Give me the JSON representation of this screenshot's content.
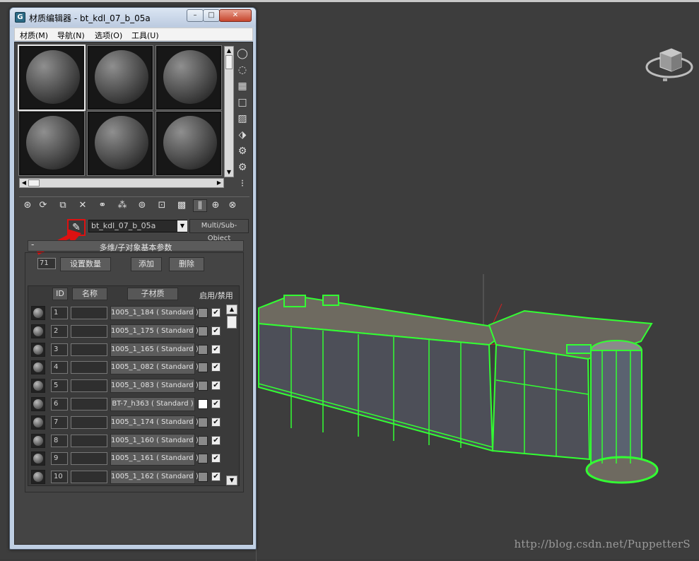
{
  "window": {
    "title": "材质编辑器 - bt_kdl_07_b_05a",
    "icon_glyph": "G"
  },
  "menu": [
    "材质(M)",
    "导航(N)",
    "选项(O)",
    "工具(U)"
  ],
  "material": {
    "name": "bt_kdl_07_b_05a",
    "type_button": "Multi/Sub-Object"
  },
  "rollout": {
    "title": "多维/子对象基本参数",
    "count": "71",
    "set_count_button": "设置数量",
    "add_button": "添加",
    "delete_button": "删除"
  },
  "columns": {
    "id": "ID",
    "name": "名称",
    "submaterial": "子材质",
    "enable": "启用/禁用"
  },
  "rows": [
    {
      "id": "1",
      "material": "1005_1_184 ( Standard )",
      "swatch": "#8a8a8a"
    },
    {
      "id": "2",
      "material": "1005_1_175 ( Standard )",
      "swatch": "#8a8a8a"
    },
    {
      "id": "3",
      "material": "1005_1_165 ( Standard )",
      "swatch": "#8a8a8a"
    },
    {
      "id": "4",
      "material": "1005_1_082 ( Standard )",
      "swatch": "#8a8a8a"
    },
    {
      "id": "5",
      "material": "1005_1_083 ( Standard )",
      "swatch": "#8a8a8a"
    },
    {
      "id": "6",
      "material": "BT-7_h363 ( Standard )",
      "swatch": "#ffffff"
    },
    {
      "id": "7",
      "material": "1005_1_174 ( Standard )",
      "swatch": "#8a8a8a"
    },
    {
      "id": "8",
      "material": "1005_1_160 ( Standard )",
      "swatch": "#8a8a8a"
    },
    {
      "id": "9",
      "material": "1005_1_161 ( Standard )",
      "swatch": "#8a8a8a"
    },
    {
      "id": "10",
      "material": "1005_1_162 ( Standard )",
      "swatch": "#8a8a8a"
    }
  ],
  "checkbox_mark": "✔",
  "watermark": "http://blog.csdn.net/PuppetterS",
  "colors": {
    "selection_green": "#33ff33",
    "highlight_red": "#dd1111",
    "viewport_bg": "#3d3d3d"
  }
}
